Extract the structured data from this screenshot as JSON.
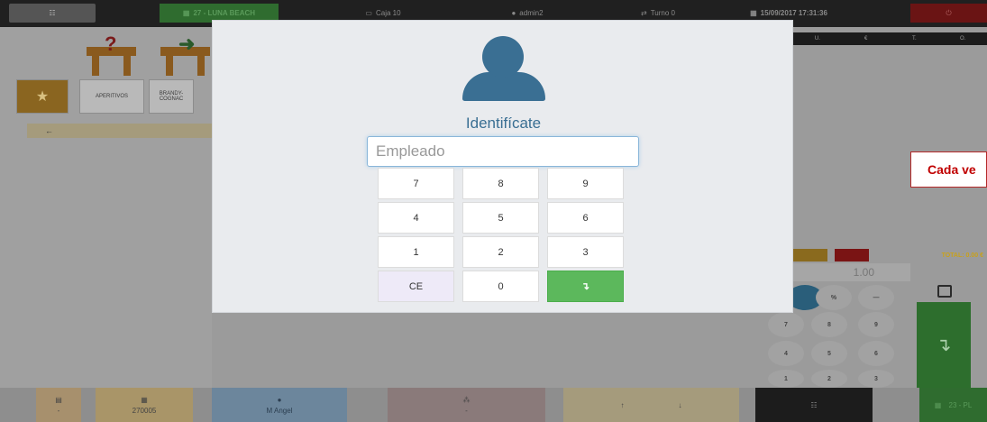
{
  "topbar": {
    "menu_icon": "grid-icon",
    "table_label": "27 - LUNA BEACH",
    "box_label": "Caja 10",
    "user_label": "admin2",
    "turn_label": "Turno 0",
    "datetime": "15/09/2017 17:31:36",
    "power_icon": "power-icon"
  },
  "sidebar": {
    "categories": [
      "APERITIVOS",
      "BRANDY-COGNAC"
    ],
    "back_label": "←"
  },
  "ticket": {
    "headers": [
      "U.",
      "€",
      "T.",
      "O."
    ],
    "total_label": "TOTAL: 0.00 €",
    "quantity": "1.00",
    "keys": [
      "%",
      "—",
      "7",
      "8",
      "9",
      "4",
      "5",
      "6",
      "1",
      "2",
      "3"
    ]
  },
  "callout": {
    "text": "Cada ve"
  },
  "bottombar": {
    "code": "270005",
    "user": "M Angel",
    "dash": "-",
    "up": "↑",
    "down": "↓",
    "next_table": "23 - PL"
  },
  "modal": {
    "title": "Identifícate",
    "employee_placeholder": "Empleado",
    "employee_value": "",
    "keys": [
      "7",
      "8",
      "9",
      "4",
      "5",
      "6",
      "1",
      "2",
      "3",
      "CE",
      "0",
      "↴"
    ],
    "accent_color": "#3a6f93",
    "ok_color": "#5cb85c"
  }
}
